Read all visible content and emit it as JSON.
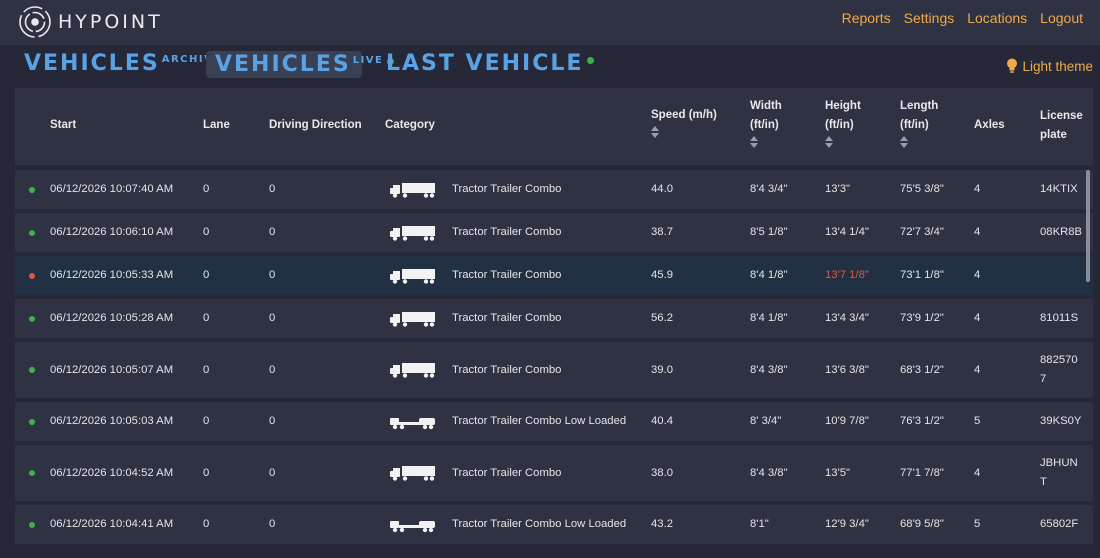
{
  "app": {
    "name": "HYPOINT"
  },
  "nav": {
    "reports": "Reports",
    "settings": "Settings",
    "locations": "Locations",
    "logout": "Logout"
  },
  "tabs": {
    "archive": {
      "main": "VEHICLES",
      "sup": "ARCHIVE"
    },
    "live": {
      "main": "VEHICLES",
      "sup": "LIVE"
    },
    "last": {
      "main": "LAST VEHICLE"
    }
  },
  "theme_toggle": "Light theme",
  "colors": {
    "accent": "#f0a94a",
    "tab_blue": "#5aa2e6",
    "ok": "#3bb34a",
    "alert": "#e0573c"
  },
  "table": {
    "headers": {
      "start": "Start",
      "lane": "Lane",
      "driving_direction": "Driving Direction",
      "category": "Category",
      "speed": "Speed (m/h)",
      "width_1": "Width",
      "width_2": "(ft/in)",
      "height_1": "Height",
      "height_2": "(ft/in)",
      "length_1": "Length",
      "length_2": "(ft/in)",
      "axles": "Axles",
      "plate_1": "License",
      "plate_2": "plate"
    },
    "rows": [
      {
        "status": "ok",
        "start": "06/12/2026 10:07:40 AM",
        "lane": "0",
        "direction": "0",
        "icon": "tractor-trailer-icon",
        "category": "Tractor Trailer Combo",
        "speed": "44.0",
        "width": "8'4 3/4\"",
        "height": "13'3\"",
        "height_alert": false,
        "length": "75'5 3/8\"",
        "axles": "4",
        "plate": [
          "14KTIX"
        ]
      },
      {
        "status": "ok",
        "start": "06/12/2026 10:06:10 AM",
        "lane": "0",
        "direction": "0",
        "icon": "tractor-trailer-icon",
        "category": "Tractor Trailer Combo",
        "speed": "38.7",
        "width": "8'5 1/8\"",
        "height": "13'4 1/4\"",
        "height_alert": false,
        "length": "72'7 3/4\"",
        "axles": "4",
        "plate": [
          "08KR8B"
        ]
      },
      {
        "status": "alert",
        "start": "06/12/2026 10:05:33 AM",
        "lane": "0",
        "direction": "0",
        "icon": "tractor-trailer-icon",
        "category": "Tractor Trailer Combo",
        "speed": "45.9",
        "width": "8'4 1/8\"",
        "height": "13'7 1/8\"",
        "height_alert": true,
        "length": "73'1 1/8\"",
        "axles": "4",
        "plate": []
      },
      {
        "status": "ok",
        "start": "06/12/2026 10:05:28 AM",
        "lane": "0",
        "direction": "0",
        "icon": "tractor-trailer-icon",
        "category": "Tractor Trailer Combo",
        "speed": "56.2",
        "width": "8'4 1/8\"",
        "height": "13'4 3/4\"",
        "height_alert": false,
        "length": "73'9 1/2\"",
        "axles": "4",
        "plate": [
          "81011S"
        ]
      },
      {
        "status": "ok",
        "start": "06/12/2026 10:05:07 AM",
        "lane": "0",
        "direction": "0",
        "icon": "tractor-trailer-icon",
        "category": "Tractor Trailer Combo",
        "speed": "39.0",
        "width": "8'4 3/8\"",
        "height": "13'6 3/8\"",
        "height_alert": false,
        "length": "68'3 1/2\"",
        "axles": "4",
        "plate": [
          "882570",
          "7"
        ]
      },
      {
        "status": "ok",
        "start": "06/12/2026 10:05:03 AM",
        "lane": "0",
        "direction": "0",
        "icon": "low-loader-icon",
        "category": "Tractor Trailer Combo Low Loaded",
        "speed": "40.4",
        "width": "8' 3/4\"",
        "height": "10'9 7/8\"",
        "height_alert": false,
        "length": "76'3 1/2\"",
        "axles": "5",
        "plate": [
          "39KS0Y"
        ]
      },
      {
        "status": "ok",
        "start": "06/12/2026 10:04:52 AM",
        "lane": "0",
        "direction": "0",
        "icon": "tractor-trailer-icon",
        "category": "Tractor Trailer Combo",
        "speed": "38.0",
        "width": "8'4 3/8\"",
        "height": "13'5\"",
        "height_alert": false,
        "length": "77'1 7/8\"",
        "axles": "4",
        "plate": [
          "JBHUN",
          "T"
        ]
      },
      {
        "status": "ok",
        "start": "06/12/2026 10:04:41 AM",
        "lane": "0",
        "direction": "0",
        "icon": "low-loader-icon",
        "category": "Tractor Trailer Combo Low Loaded",
        "speed": "43.2",
        "width": "8'1\"",
        "height": "12'9 3/4\"",
        "height_alert": false,
        "length": "68'9 5/8\"",
        "axles": "5",
        "plate": [
          "65802F"
        ]
      }
    ]
  }
}
